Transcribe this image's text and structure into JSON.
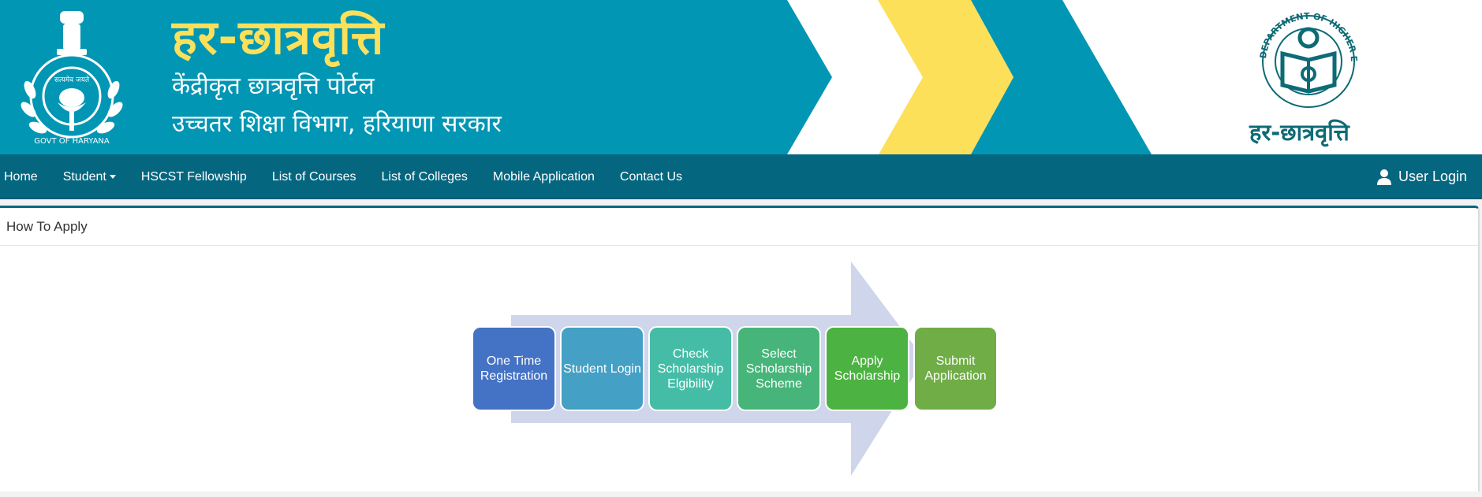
{
  "header": {
    "title_hindi": "हर-छात्रवृत्ति",
    "subtitle_line1": "केंद्रीकृत छात्रवृत्ति पोर्टल",
    "subtitle_line2": "उच्चतर शिक्षा विभाग, हरियाणा सरकार",
    "emblem_text_top": "सत्यमेव जयते",
    "emblem_text_bottom": "GOVT OF HARYANA",
    "dhe_logo_ring_text": "DEPARTMENT OF HIGHER EDUCATION HARYANA",
    "dhe_logo_name": "हर-छात्रवृत्ति",
    "colors": {
      "teal": "#0096b4",
      "yellow": "#fce05a",
      "logo_teal": "#0d6b76"
    }
  },
  "nav": {
    "items": [
      {
        "label": "Home"
      },
      {
        "label": "Student",
        "dropdown": true
      },
      {
        "label": "HSCST Fellowship"
      },
      {
        "label": "List of Courses"
      },
      {
        "label": "List of Colleges"
      },
      {
        "label": "Mobile Application"
      },
      {
        "label": "Contact Us"
      }
    ],
    "user_login": "User Login",
    "user_icon": "user-icon",
    "background": "#05667f"
  },
  "card": {
    "title": "How To Apply",
    "steps": [
      {
        "label": "One Time Registration",
        "color": "#4472c4"
      },
      {
        "label": "Student Login",
        "color": "#44a0c4"
      },
      {
        "label": "Check Scholarship Elgibility",
        "color": "#45bda6"
      },
      {
        "label": "Select Scholarship Scheme",
        "color": "#47b57a"
      },
      {
        "label": "Apply Scholarship",
        "color": "#4cb241"
      },
      {
        "label": "Submit Application",
        "color": "#70ad47"
      }
    ],
    "arrow_color": "#cfd5ea"
  }
}
